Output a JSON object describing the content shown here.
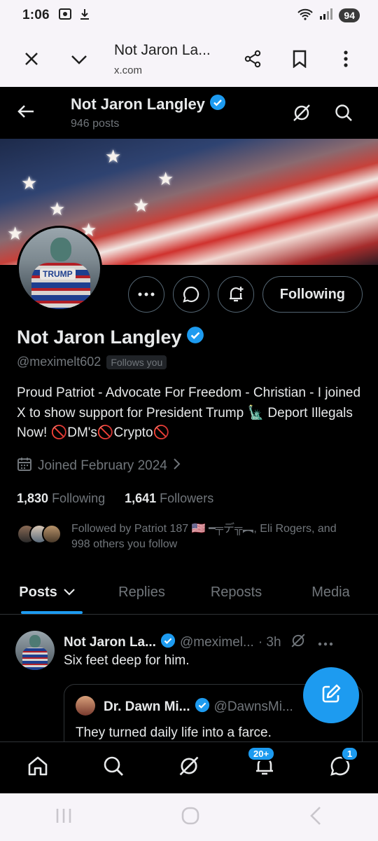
{
  "status_bar": {
    "time": "1:06",
    "battery": "94"
  },
  "browser": {
    "title": "Not Jaron La...",
    "domain": "x.com"
  },
  "topnav": {
    "name": "Not Jaron Langley",
    "posts_count": "946 posts"
  },
  "profile": {
    "name": "Not Jaron Langley",
    "handle": "@meximelt602",
    "follows_you": "Follows you",
    "bio": "Proud Patriot - Advocate For Freedom - Christian - I joined X to show support for President Trump 🗽 Deport Illegals Now! 🚫DM's🚫Crypto🚫",
    "joined": "Joined February 2024",
    "following_count": "1,830",
    "following_label": "Following",
    "followers_count": "1,641",
    "followers_label": "Followers",
    "followed_by": "Followed by Patriot 187 🇺🇸 ━╤デ╦︻, Eli Rogers, and 998 others you follow",
    "avatar_text": "TRUMP"
  },
  "actions": {
    "following_button": "Following"
  },
  "tabs": [
    {
      "label": "Posts"
    },
    {
      "label": "Replies"
    },
    {
      "label": "Reposts"
    },
    {
      "label": "Media"
    }
  ],
  "post": {
    "author": "Not Jaron La...",
    "handle": "@meximel...",
    "time": "· 3h",
    "text": "Six feet deep for him.",
    "quote": {
      "author": "Dr. Dawn Mi...",
      "handle": "@DawnsMi...",
      "text": "They turned daily life into a farce."
    }
  },
  "bottom_nav": {
    "notifications_badge": "20+",
    "messages_badge": "1"
  },
  "colors": {
    "accent": "#1d9bf0",
    "background": "#000000",
    "muted": "#71767b"
  }
}
